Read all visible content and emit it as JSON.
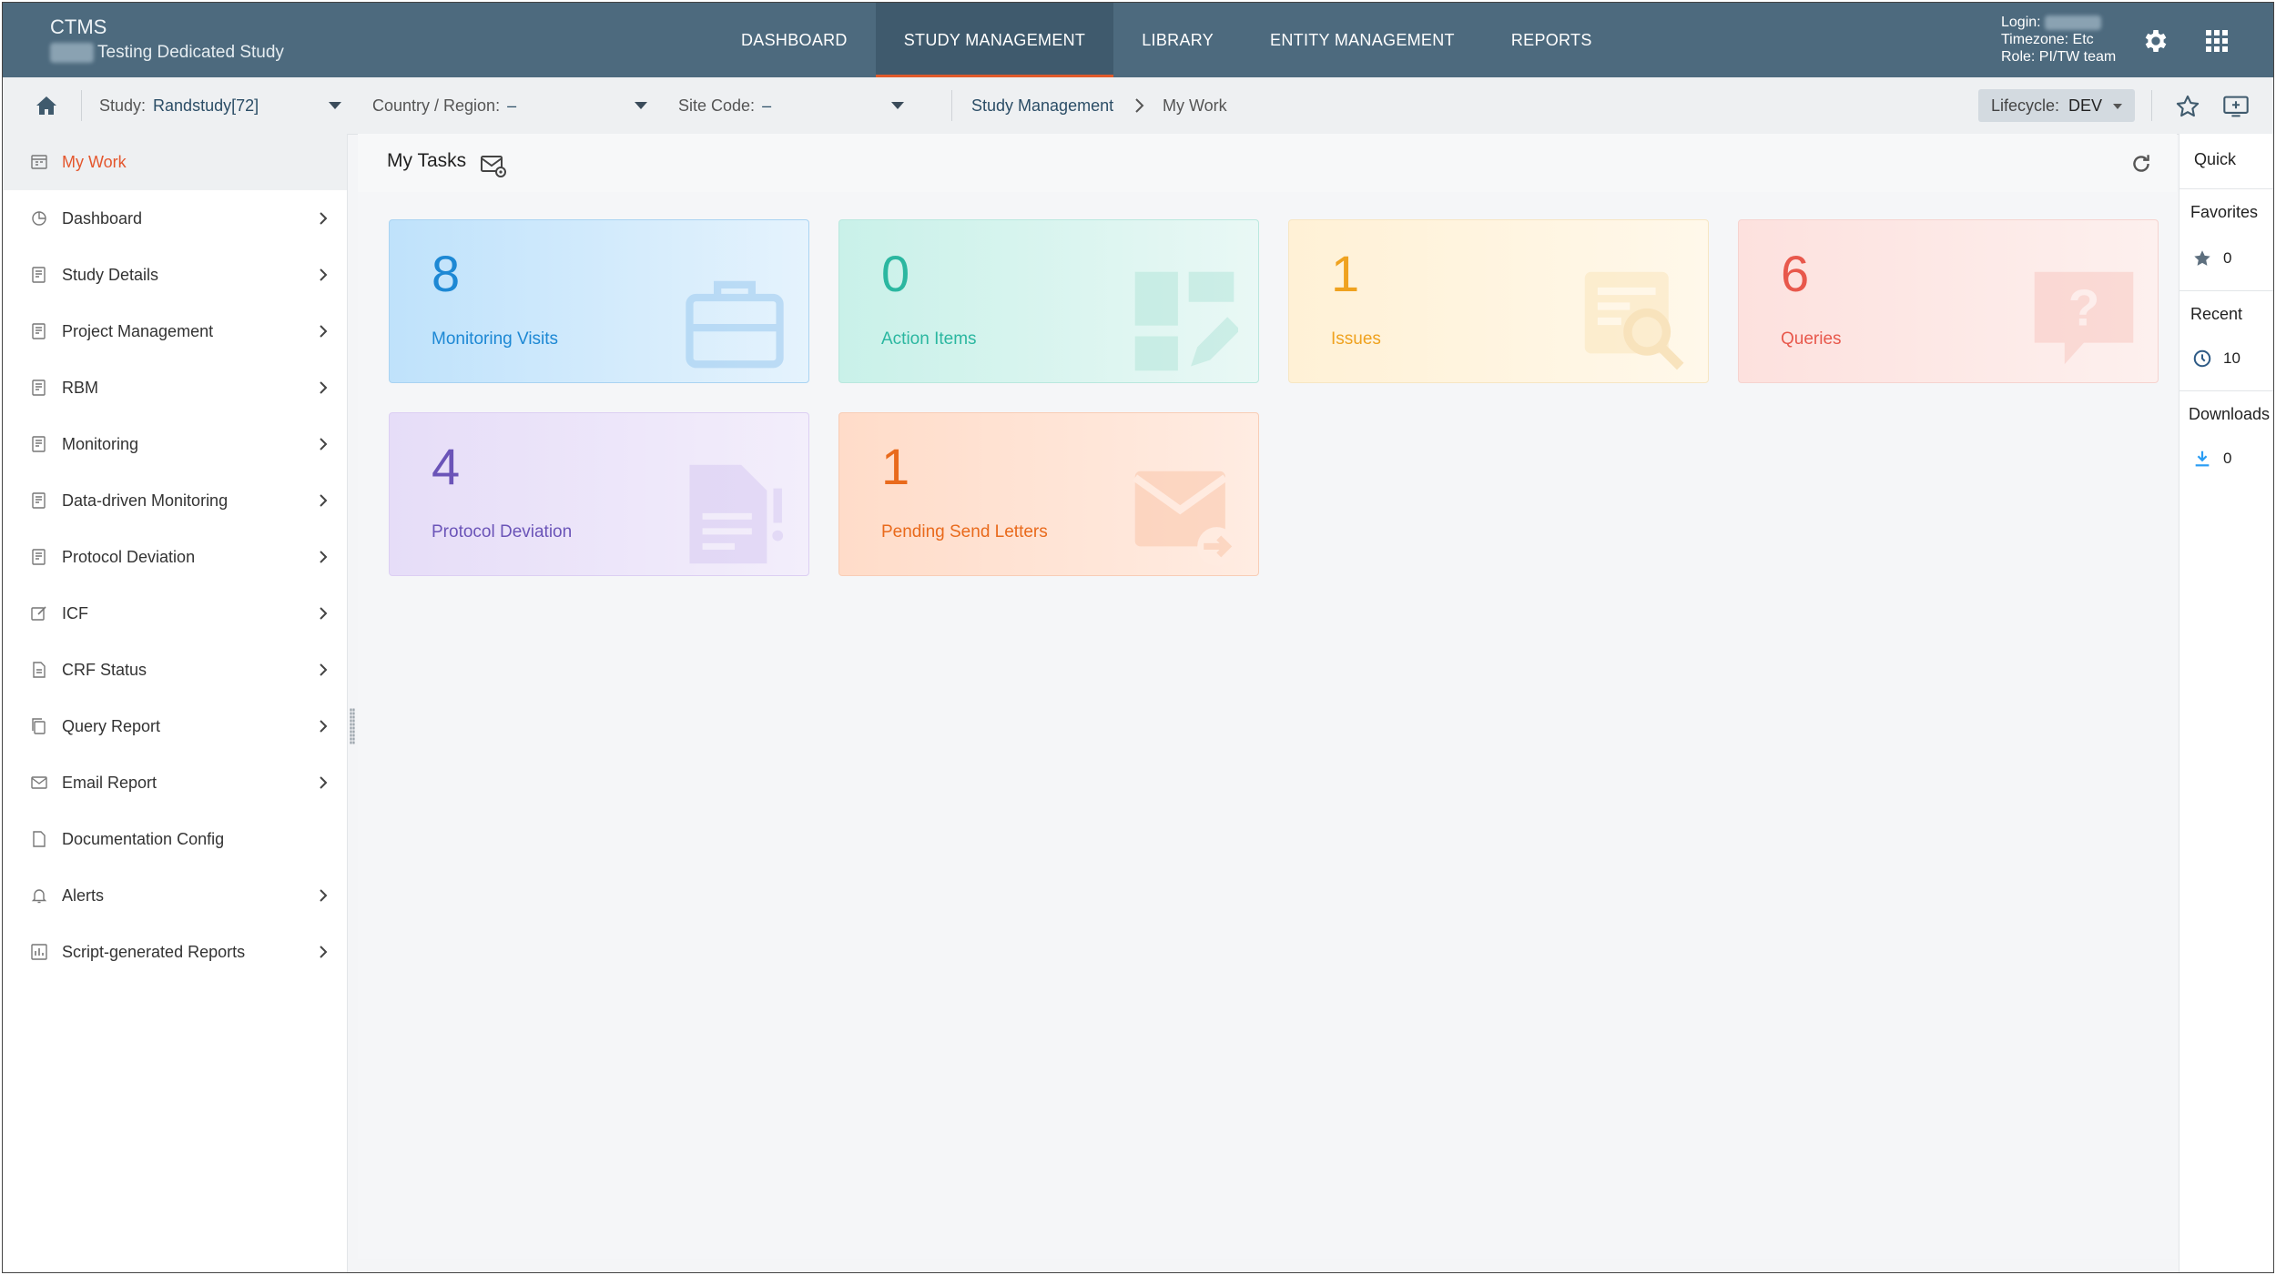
{
  "app": {
    "name": "CTMS",
    "study_name": "Testing Dedicated Study"
  },
  "nav": {
    "tabs": [
      {
        "label": "DASHBOARD"
      },
      {
        "label": "STUDY MANAGEMENT"
      },
      {
        "label": "LIBRARY"
      },
      {
        "label": "ENTITY MANAGEMENT"
      },
      {
        "label": "REPORTS"
      }
    ]
  },
  "user": {
    "login_label": "Login:",
    "timezone": "Timezone: Etc",
    "role": "Role: PI/TW team"
  },
  "subbar": {
    "study_label": "Study:",
    "study_value": "Randstudy[72]",
    "country_label": "Country / Region:",
    "country_value": "–",
    "site_label": "Site Code:",
    "site_value": "–",
    "breadcrumb": [
      "Study Management",
      "My Work"
    ],
    "lifecycle_label": "Lifecycle:",
    "lifecycle_value": "DEV"
  },
  "sidebar": {
    "items": [
      {
        "label": "My Work",
        "icon": "calendar-icon",
        "has_children": false
      },
      {
        "label": "Dashboard",
        "icon": "pie-chart-icon",
        "has_children": true
      },
      {
        "label": "Study Details",
        "icon": "document-icon",
        "has_children": true
      },
      {
        "label": "Project Management",
        "icon": "document-icon",
        "has_children": true
      },
      {
        "label": "RBM",
        "icon": "document-icon",
        "has_children": true
      },
      {
        "label": "Monitoring",
        "icon": "document-icon",
        "has_children": true
      },
      {
        "label": "Data-driven Monitoring",
        "icon": "document-icon",
        "has_children": true
      },
      {
        "label": "Protocol Deviation",
        "icon": "document-icon",
        "has_children": true
      },
      {
        "label": "ICF",
        "icon": "edit-icon",
        "has_children": true
      },
      {
        "label": "CRF Status",
        "icon": "file-icon",
        "has_children": true
      },
      {
        "label": "Query Report",
        "icon": "copy-icon",
        "has_children": true
      },
      {
        "label": "Email Report",
        "icon": "envelope-icon",
        "has_children": true
      },
      {
        "label": "Documentation Config",
        "icon": "file-icon",
        "has_children": false
      },
      {
        "label": "Alerts",
        "icon": "bell-icon",
        "has_children": true
      },
      {
        "label": "Script-generated Reports",
        "icon": "report-icon",
        "has_children": true
      }
    ]
  },
  "tasks": {
    "title": "My Tasks",
    "cards": [
      {
        "count": "8",
        "label": "Monitoring Visits",
        "icon": "briefcase-icon"
      },
      {
        "count": "0",
        "label": "Action Items",
        "icon": "dashboard-edit-icon"
      },
      {
        "count": "1",
        "label": "Issues",
        "icon": "search-document-icon"
      },
      {
        "count": "6",
        "label": "Queries",
        "icon": "question-bubble-icon"
      },
      {
        "count": "4",
        "label": "Protocol Deviation",
        "icon": "document-alert-icon"
      },
      {
        "count": "1",
        "label": "Pending Send Letters",
        "icon": "envelope-forward-icon"
      }
    ]
  },
  "quick": {
    "title": "Quick",
    "favorites_label": "Favorites",
    "favorites_count": "0",
    "recent_label": "Recent",
    "recent_count": "10",
    "downloads_label": "Downloads",
    "downloads_count": "0"
  },
  "colors": {
    "topbar": "#4d6a7e",
    "active_tab_underline": "#e05a2b",
    "active_sidebar_text": "#e4572e"
  }
}
